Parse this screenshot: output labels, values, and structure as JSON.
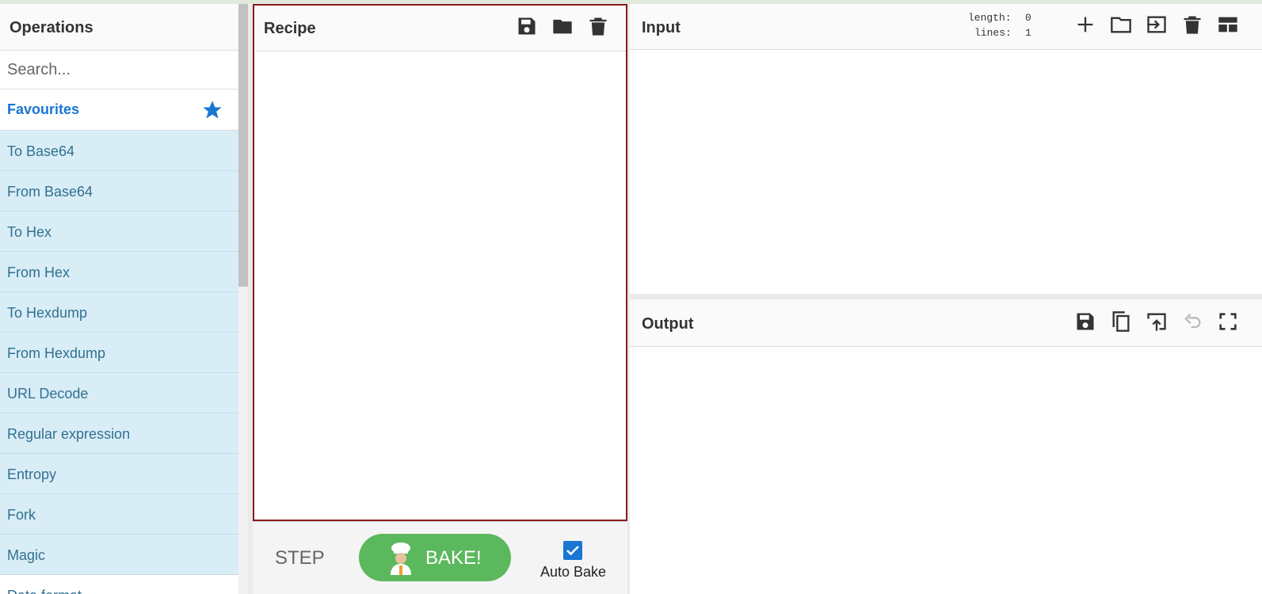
{
  "operations": {
    "title": "Operations",
    "search_placeholder": "Search...",
    "favourites_label": "Favourites",
    "items": [
      "To Base64",
      "From Base64",
      "To Hex",
      "From Hex",
      "To Hexdump",
      "From Hexdump",
      "URL Decode",
      "Regular expression",
      "Entropy",
      "Fork",
      "Magic",
      "Data format"
    ]
  },
  "recipe": {
    "title": "Recipe",
    "icons": [
      "save-icon",
      "folder-icon",
      "trash-icon"
    ]
  },
  "controls": {
    "step_label": "STEP",
    "bake_label": "BAKE!",
    "auto_bake_label": "Auto Bake",
    "auto_bake_checked": true
  },
  "input": {
    "title": "Input",
    "length_label": "length:",
    "length_value": "0",
    "lines_label": "lines:",
    "lines_value": "1",
    "icons": [
      "plus-icon",
      "folder-icon",
      "import-icon",
      "trash-icon",
      "layout-icon"
    ]
  },
  "output": {
    "title": "Output",
    "icons": [
      "save-icon",
      "copy-icon",
      "replace-input-icon",
      "undo-icon",
      "fullscreen-icon"
    ]
  },
  "colors": {
    "accent": "#1976d2",
    "bake_green": "#5cb85c",
    "op_item_bg": "#d9edf7",
    "op_item_text": "#31708f",
    "highlight": "#8b1a1a"
  }
}
